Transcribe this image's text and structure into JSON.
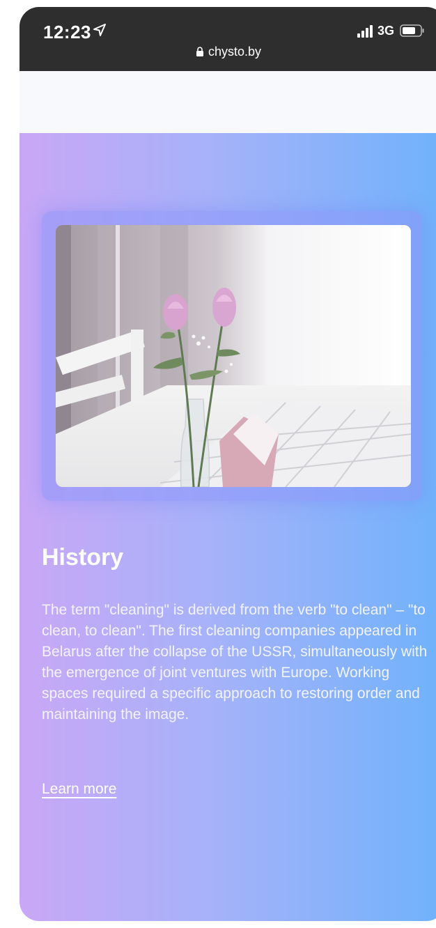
{
  "status_bar": {
    "time": "12:23",
    "network": "3G",
    "url": "chysto.by"
  },
  "section": {
    "title": "History",
    "body": "The term \"cleaning\" is derived from the verb \"to clean\" – \"to clean, to clean\". The first cleaning companies appeared in Belarus after the collapse of the USSR, simultaneously with the emergence of joint ventures with Europe. Working spaces required a specific approach to restoring order and maintaining the image.",
    "link_label": "Learn more"
  },
  "colors": {
    "status_bar_bg": "#2e2e2e",
    "gradient_start": "#c9a7f6",
    "gradient_end": "#6fb2fb",
    "text": "#ffffff"
  },
  "icons": [
    "location-arrow-icon",
    "lock-icon",
    "signal-icon",
    "battery-icon"
  ]
}
